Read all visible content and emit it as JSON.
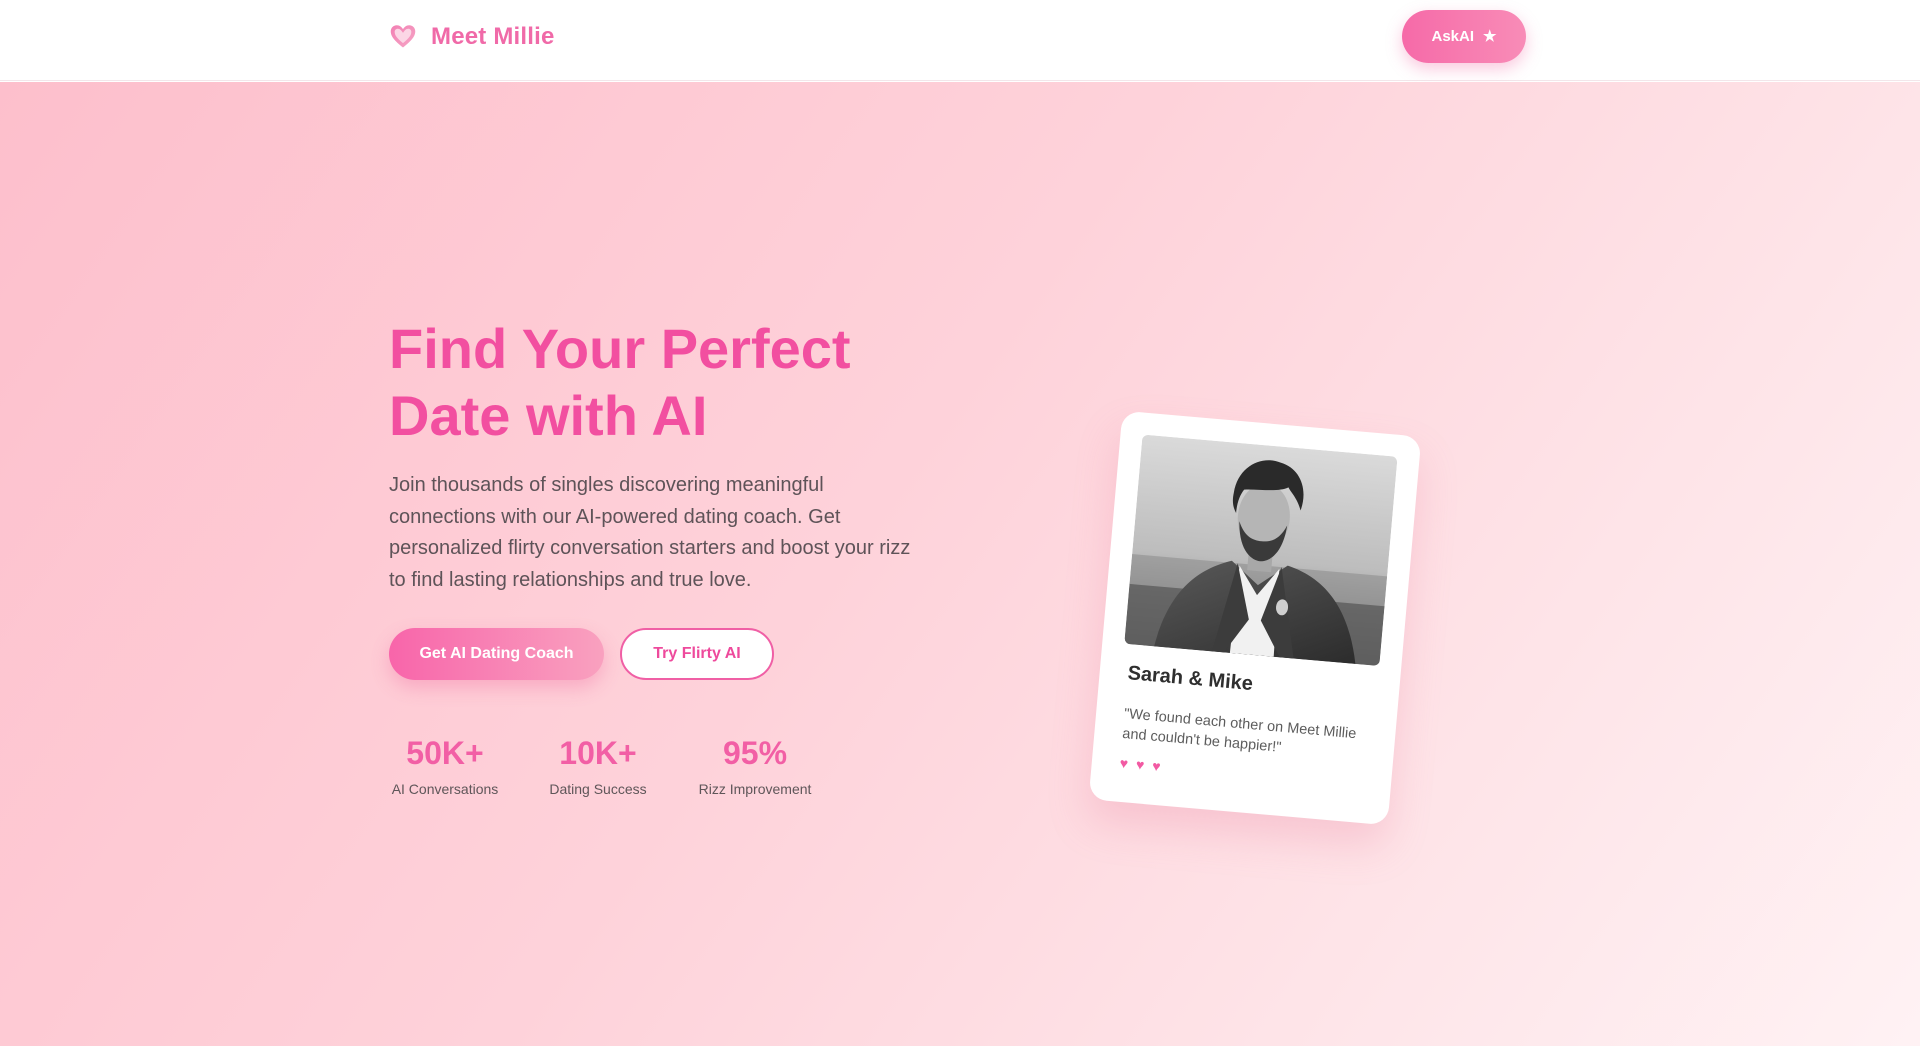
{
  "nav": {
    "brand_name": "Meet Millie",
    "brand_icon": "heart-icon",
    "askai_label": "AskAI",
    "askai_icon": "star-icon",
    "star_glyph": "★"
  },
  "hero": {
    "title_line1": "Find Your Perfect",
    "title_line2": "Date with AI",
    "description": "Join thousands of singles discovering meaningful connections with our AI-powered dating coach. Get personalized flirty conversation starters and boost your rizz to find lasting relationships and true love.",
    "primary_button": "Get AI Dating Coach",
    "secondary_button": "Try Flirty AI"
  },
  "stats": [
    {
      "value": "50K+",
      "label": "AI Conversations"
    },
    {
      "value": "10K+",
      "label": "Dating Success"
    },
    {
      "value": "95%",
      "label": "Rizz Improvement"
    }
  ],
  "testimonial": {
    "name": "Sarah & Mike",
    "quote": "\"We found each other on Meet Millie and couldn't be happier!\"",
    "heart_glyph": "♥",
    "heart_count": 3
  },
  "colors": {
    "accent": "#f24fa0",
    "accent_light": "#f88cb7",
    "hero_bg_start": "#fdbfcc",
    "hero_bg_end": "#fff2f4",
    "text_body": "#5e5358"
  }
}
